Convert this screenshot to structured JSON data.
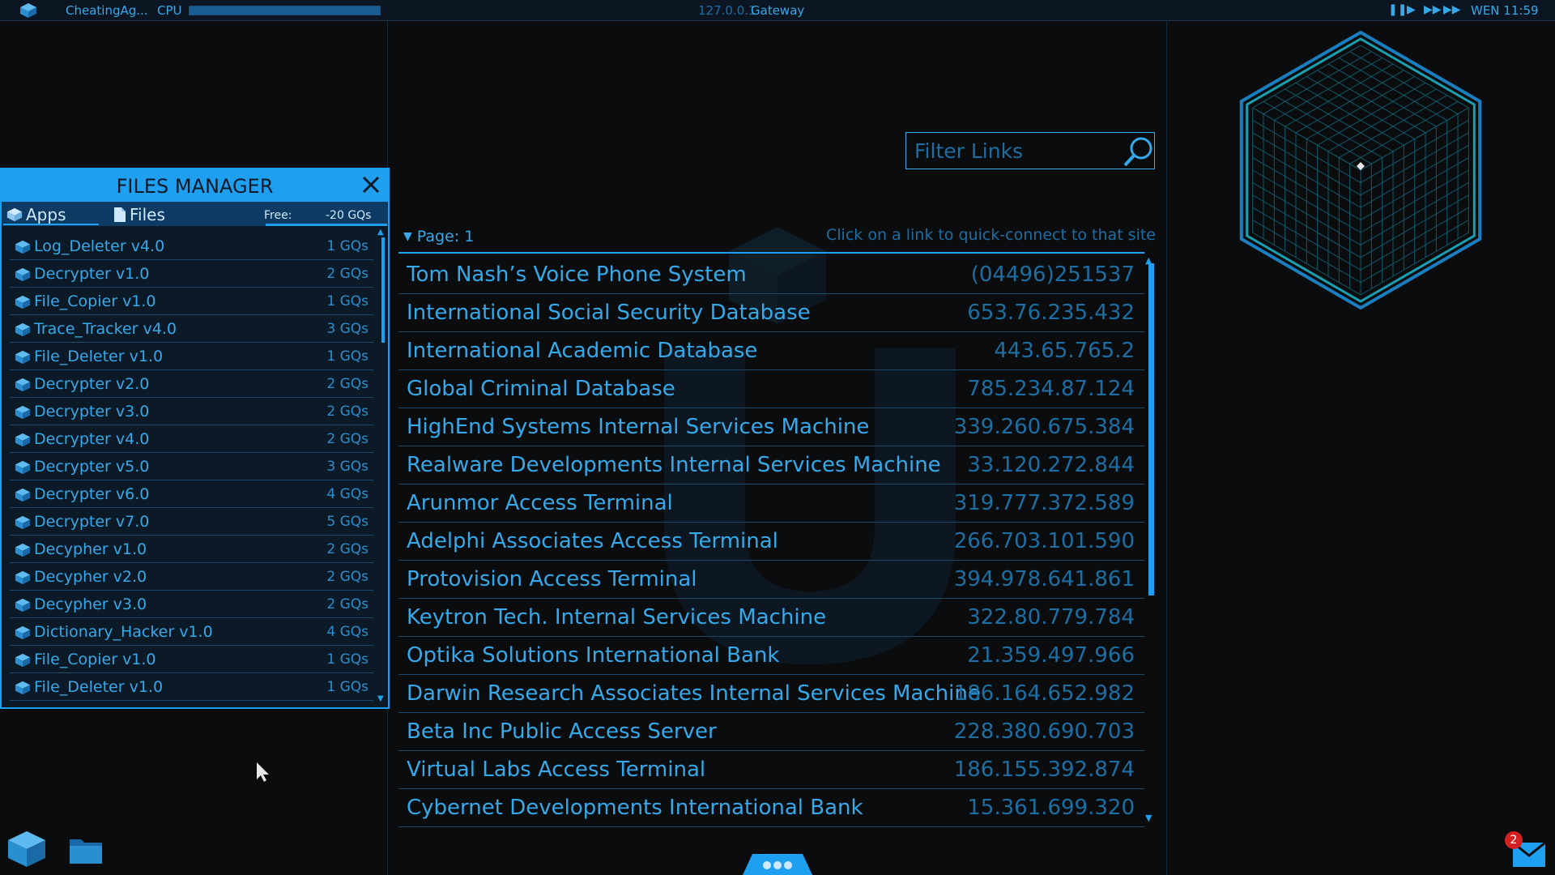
{
  "topbar": {
    "username": "CheatingAg...",
    "cpu_label": "CPU",
    "cpu_usage": 1.0,
    "ip": "127.0.0.1",
    "gateway_label": "Gateway",
    "media_icons": [
      "pause-icon",
      "play-icon",
      "fast-forward-icon",
      "fastest-forward-icon"
    ],
    "clock": "WEN 11:59"
  },
  "files_manager": {
    "title": "FILES MANAGER",
    "tabs": [
      {
        "label": "Apps",
        "icon": "cube-icon"
      },
      {
        "label": "Files",
        "icon": "file-icon"
      }
    ],
    "free_label": "Free:",
    "free_value": "-20 GQs",
    "items": [
      {
        "name": "Log_Deleter v4.0",
        "size": "1 GQs"
      },
      {
        "name": "Decrypter v1.0",
        "size": "2 GQs"
      },
      {
        "name": "File_Copier v1.0",
        "size": "1 GQs"
      },
      {
        "name": "Trace_Tracker v4.0",
        "size": "3 GQs"
      },
      {
        "name": "File_Deleter v1.0",
        "size": "1 GQs"
      },
      {
        "name": "Decrypter v2.0",
        "size": "2 GQs"
      },
      {
        "name": "Decrypter v3.0",
        "size": "2 GQs"
      },
      {
        "name": "Decrypter v4.0",
        "size": "2 GQs"
      },
      {
        "name": "Decrypter v5.0",
        "size": "3 GQs"
      },
      {
        "name": "Decrypter v6.0",
        "size": "4 GQs"
      },
      {
        "name": "Decrypter v7.0",
        "size": "5 GQs"
      },
      {
        "name": "Decypher v1.0",
        "size": "2 GQs"
      },
      {
        "name": "Decypher v2.0",
        "size": "2 GQs"
      },
      {
        "name": "Decypher v3.0",
        "size": "2 GQs"
      },
      {
        "name": "Dictionary_Hacker v1.0",
        "size": "4 GQs"
      },
      {
        "name": "File_Copier v1.0",
        "size": "1 GQs"
      },
      {
        "name": "File_Deleter v1.0",
        "size": "1 GQs"
      }
    ]
  },
  "links": {
    "filter_placeholder": "Filter Links",
    "page_label": "Page: 1",
    "hint": "Click on a link to quick-connect to that site",
    "items": [
      {
        "name": "Tom Nash’s Voice Phone System",
        "address": "(04496)251537"
      },
      {
        "name": "International Social Security Database",
        "address": "653.76.235.432"
      },
      {
        "name": "International Academic Database",
        "address": "443.65.765.2"
      },
      {
        "name": "Global Criminal Database",
        "address": "785.234.87.124"
      },
      {
        "name": "HighEnd Systems Internal Services Machine",
        "address": "339.260.675.384"
      },
      {
        "name": "Realware Developments Internal Services Machine",
        "address": "33.120.272.844"
      },
      {
        "name": "Arunmor Access Terminal",
        "address": "319.777.372.589"
      },
      {
        "name": "Adelphi Associates Access Terminal",
        "address": "266.703.101.590"
      },
      {
        "name": "Protovision Access Terminal",
        "address": "394.978.641.861"
      },
      {
        "name": "Keytron Tech. Internal Services Machine",
        "address": "322.80.779.784"
      },
      {
        "name": "Optika Solutions International Bank",
        "address": "21.359.497.966"
      },
      {
        "name": "Darwin Research Associates Internal Services Machine",
        "address": "186.164.652.982"
      },
      {
        "name": "Beta Inc Public Access Server",
        "address": "228.380.690.703"
      },
      {
        "name": "Virtual Labs Access Terminal",
        "address": "186.155.392.874"
      },
      {
        "name": "Cybernet Developments International Bank",
        "address": "15.361.699.320"
      }
    ]
  },
  "mail": {
    "unread_count": "2"
  },
  "colors": {
    "accent": "#1e9ff0",
    "text": "#35a9ea",
    "dim": "#1d6ea3",
    "background": "#0a0c0e",
    "badge": "#d42020"
  }
}
